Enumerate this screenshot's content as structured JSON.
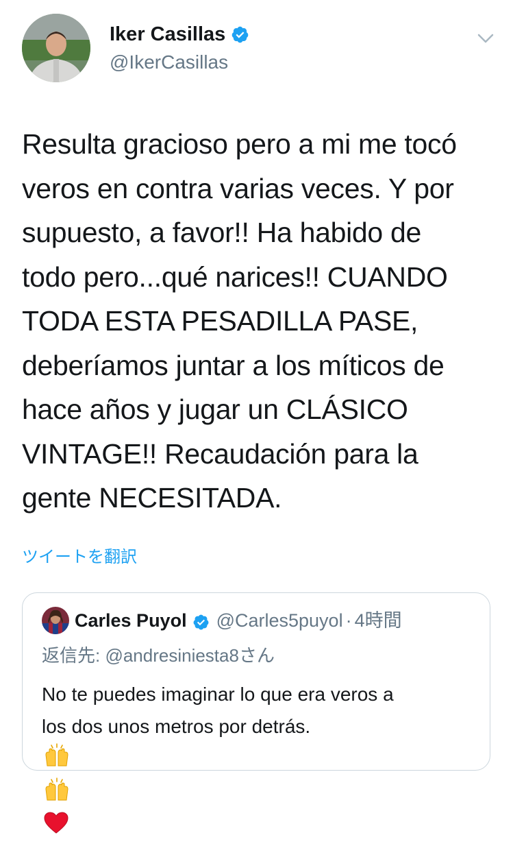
{
  "author": {
    "display_name": "Iker Casillas",
    "handle": "@IkerCasillas",
    "verified": true
  },
  "tweet": {
    "text_lines": [
      "Resulta gracioso pero a mi me tocó",
      "veros en contra varias veces. Y por",
      "supuesto, a favor!! Ha habido de",
      "todo pero...qué narices!! CUANDO",
      "TODA ESTA PESADILLA PASE,",
      "deberíamos juntar a los míticos de",
      "hace años y jugar un CLÁSICO",
      "VINTAGE!! Recaudación para la",
      "gente NECESITADA."
    ],
    "translate_label": "ツイートを翻訳"
  },
  "quoted_tweet": {
    "display_name": "Carles Puyol",
    "handle": "@Carles5puyol",
    "separator": "·",
    "time": "4時間",
    "reply_to": "返信先: @andresiniesta8さん",
    "text_lines": [
      "No te puedes imaginar lo que era veros a",
      "los dos unos metros por detrás."
    ],
    "emojis": [
      "raising-hands-emoji",
      "raising-hands-emoji",
      "red-heart-emoji"
    ]
  },
  "icons": {
    "verified": "verified-badge-icon",
    "menu": "chevron-down-icon"
  },
  "colors": {
    "accent": "#1da1f2",
    "secondary_text": "#657786",
    "border": "#ccd6dd",
    "primary_text": "#14171a"
  }
}
